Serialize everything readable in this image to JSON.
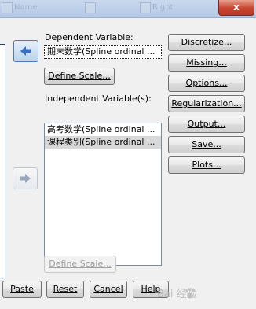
{
  "titlebar": {
    "ghost_texts": [
      "Name",
      "Right"
    ],
    "close_glyph": "x"
  },
  "dependent": {
    "label": "Dependent Variable:",
    "value": "期末数学(Spline ordinal ...",
    "define_scale": "Define Scale..."
  },
  "independent": {
    "label": "Independent Variable(s):",
    "items": [
      "高考数学(Spline ordinal ...",
      "课程类别(Spline ordinal ..."
    ],
    "define_scale": "Define Scale..."
  },
  "side_buttons": [
    "Discretize...",
    "Missing...",
    "Options...",
    "Regularization...",
    "Output...",
    "Save...",
    "Plots..."
  ],
  "bottom_buttons": [
    "Paste",
    "Reset",
    "Cancel",
    "Help"
  ],
  "watermark": "Bai 经验",
  "colors": {
    "arrow": "#3a6ec0",
    "arrow_disabled": "#9aa7b8"
  }
}
